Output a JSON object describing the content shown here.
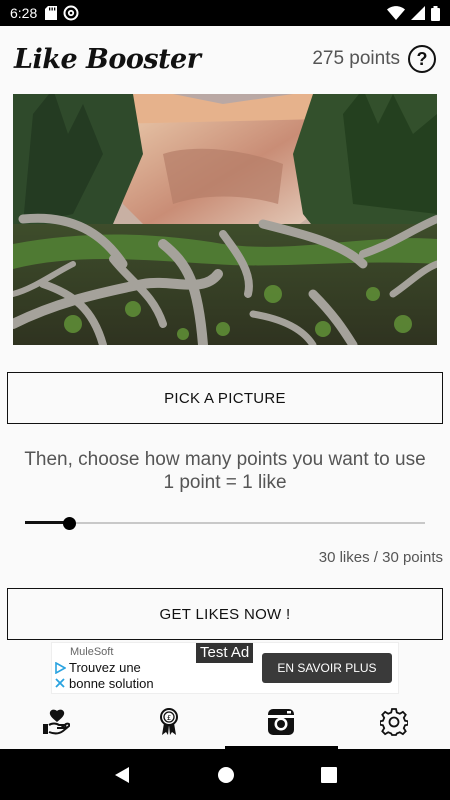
{
  "status_bar": {
    "time": "6:28"
  },
  "header": {
    "title": "Like Booster",
    "points": "275 points",
    "help_symbol": "?"
  },
  "photo": {
    "icon": "landscape-photo"
  },
  "pick_button": {
    "label": "PICK A PICTURE"
  },
  "instructions": {
    "line1": "Then, choose how many points you want to use",
    "line2": "1 point = 1 like"
  },
  "slider": {
    "value": 30,
    "fraction": 0.11
  },
  "likes_summary": "30 likes / 30 points",
  "get_likes_button": {
    "label": "GET LIKES NOW !"
  },
  "ad": {
    "advertiser": "MuleSoft",
    "tag": "Test Ad",
    "headline": "Trouvez une bonne solution",
    "cta": "EN SAVOIR PLUS"
  },
  "bottom_nav": {
    "items": [
      {
        "icon": "heart-hand-icon"
      },
      {
        "icon": "award-ribbon-icon"
      },
      {
        "icon": "camera-icon",
        "active": true
      },
      {
        "icon": "gear-icon"
      }
    ]
  },
  "colors": {
    "accent": "#000000",
    "background": "#fafafa",
    "text_muted": "#555555"
  }
}
